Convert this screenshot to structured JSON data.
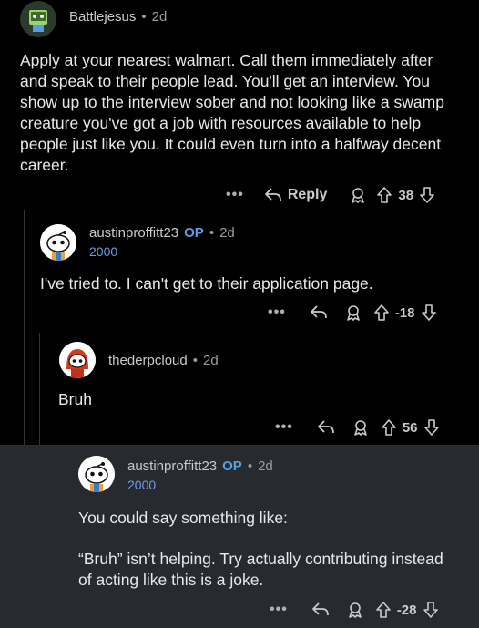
{
  "comments": [
    {
      "username": "Battlejesus",
      "age": "2d",
      "body": "Apply at your nearest walmart. Call them immediately after and speak to their people lead. You'll get an interview. You show up to the interview sober and not looking like a swamp creature you've got a job with resources available to help people just like you. It could even turn into a halfway decent career.",
      "more": "•••",
      "reply_label": "Reply",
      "score": "38"
    },
    {
      "username": "austinproffitt23",
      "op_badge": "OP",
      "age": "2d",
      "flair": "2000",
      "body": "I've tried to. I can't get to their application page.",
      "more": "•••",
      "score": "-18"
    },
    {
      "username": "thederpcloud",
      "age": "2d",
      "body": "Bruh",
      "more": "•••",
      "score": "56"
    },
    {
      "username": "austinproffitt23",
      "op_badge": "OP",
      "age": "2d",
      "flair": "2000",
      "body_line1": "You could say something like:",
      "body_line2": "“Bruh” isn’t helping. Try actually contributing instead of acting like this is a joke.",
      "more": "•••",
      "score": "-28"
    }
  ],
  "colors": {
    "background": "#000000",
    "highlight": "#272a2f",
    "op": "#5b9ee6",
    "flair": "#6a9ee0"
  }
}
